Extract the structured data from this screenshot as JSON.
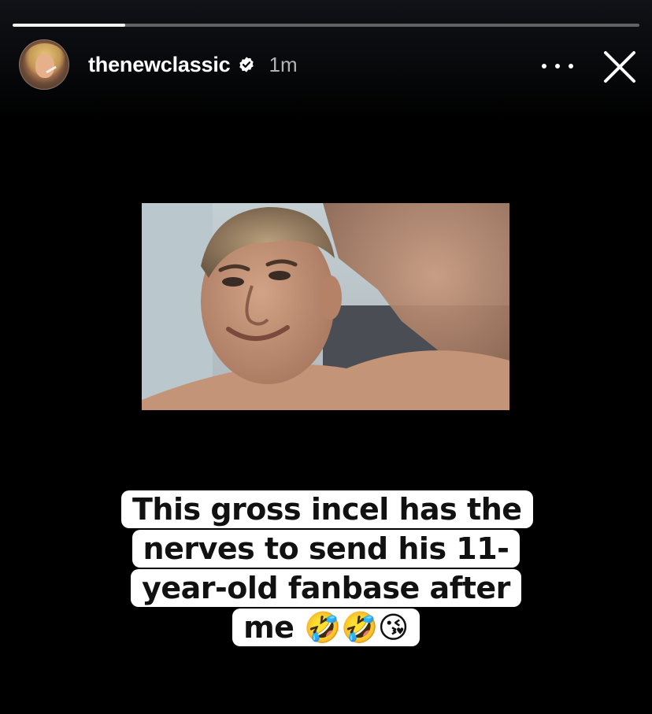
{
  "story": {
    "progress": 0.18,
    "username": "thenewclassic",
    "verified": true,
    "timestamp": "1m",
    "caption": "This gross incel has the nerves to send his 11-year-old fanbase after me 🤣🤣😘"
  },
  "icons": {
    "verified": "verified-badge-icon",
    "more": "more-options-icon",
    "close": "close-icon"
  },
  "colors": {
    "background": "#000000",
    "caption_box": "#ffffff",
    "caption_text": "#111111",
    "timestamp": "#b3b3b3"
  }
}
